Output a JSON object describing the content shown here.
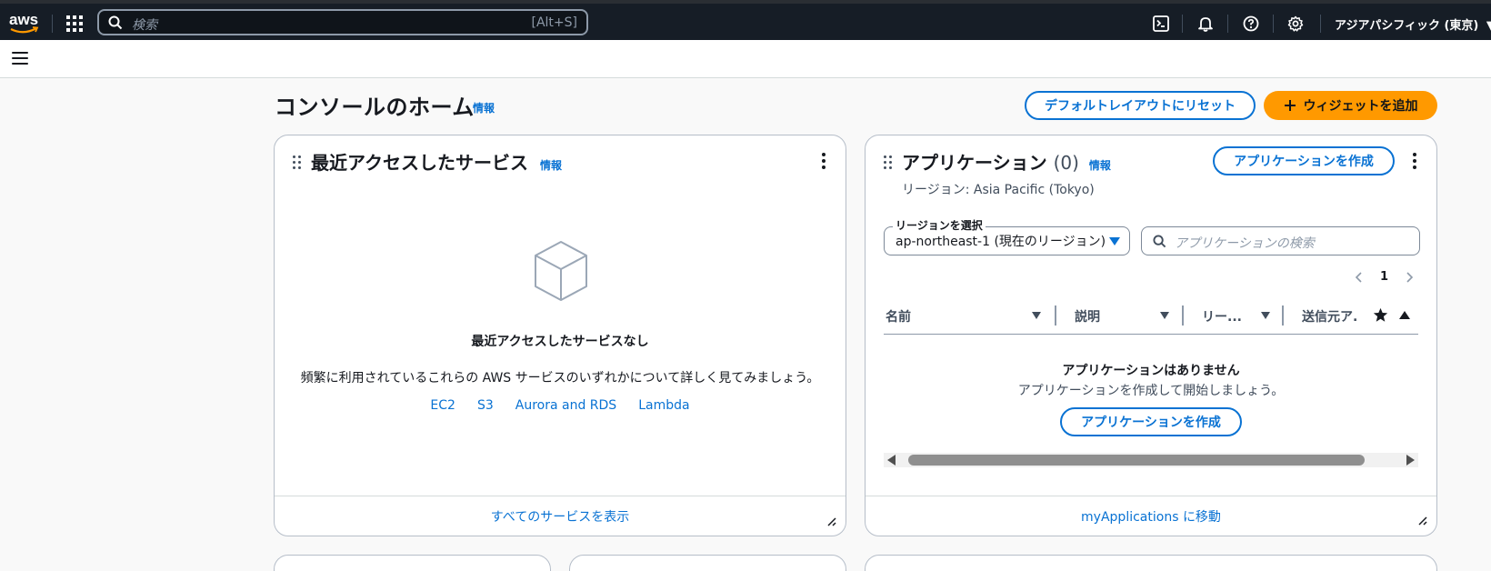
{
  "nav": {
    "search_placeholder": "検索",
    "search_shortcut": "[Alt+S]",
    "region": "アジアパシフィック (東京)"
  },
  "header": {
    "title": "コンソールのホーム",
    "info": "情報",
    "reset_layout": "デフォルトレイアウトにリセット",
    "add_widget": "ウィジェットを追加"
  },
  "recent": {
    "title": "最近アクセスしたサービス",
    "info": "情報",
    "empty_title": "最近アクセスしたサービスなし",
    "empty_desc": "頻繁に利用されているこれらの AWS サービスのいずれかについて詳しく見てみましょう。",
    "services": [
      "EC2",
      "S3",
      "Aurora and RDS",
      "Lambda"
    ],
    "footer_link": "すべてのサービスを表示"
  },
  "apps": {
    "title": "アプリケーション",
    "count": "(0)",
    "info": "情報",
    "create_button": "アプリケーションを作成",
    "region_label": "リージョン: Asia Pacific (Tokyo)",
    "select_legend": "リージョンを選択",
    "select_value": "ap-northeast-1 (現在のリージョン)",
    "search_placeholder": "アプリケーションの検索",
    "page": "1",
    "columns": [
      "名前",
      "説明",
      "リー...",
      "送信元ア..."
    ],
    "empty_title": "アプリケーションはありません",
    "empty_desc": "アプリケーションを作成して開始しましょう。",
    "empty_create": "アプリケーションを作成",
    "footer_link": "myApplications に移動"
  },
  "colors": {
    "nav_bg": "#161d26",
    "link": "#0972d3",
    "accent": "#ff9900"
  }
}
